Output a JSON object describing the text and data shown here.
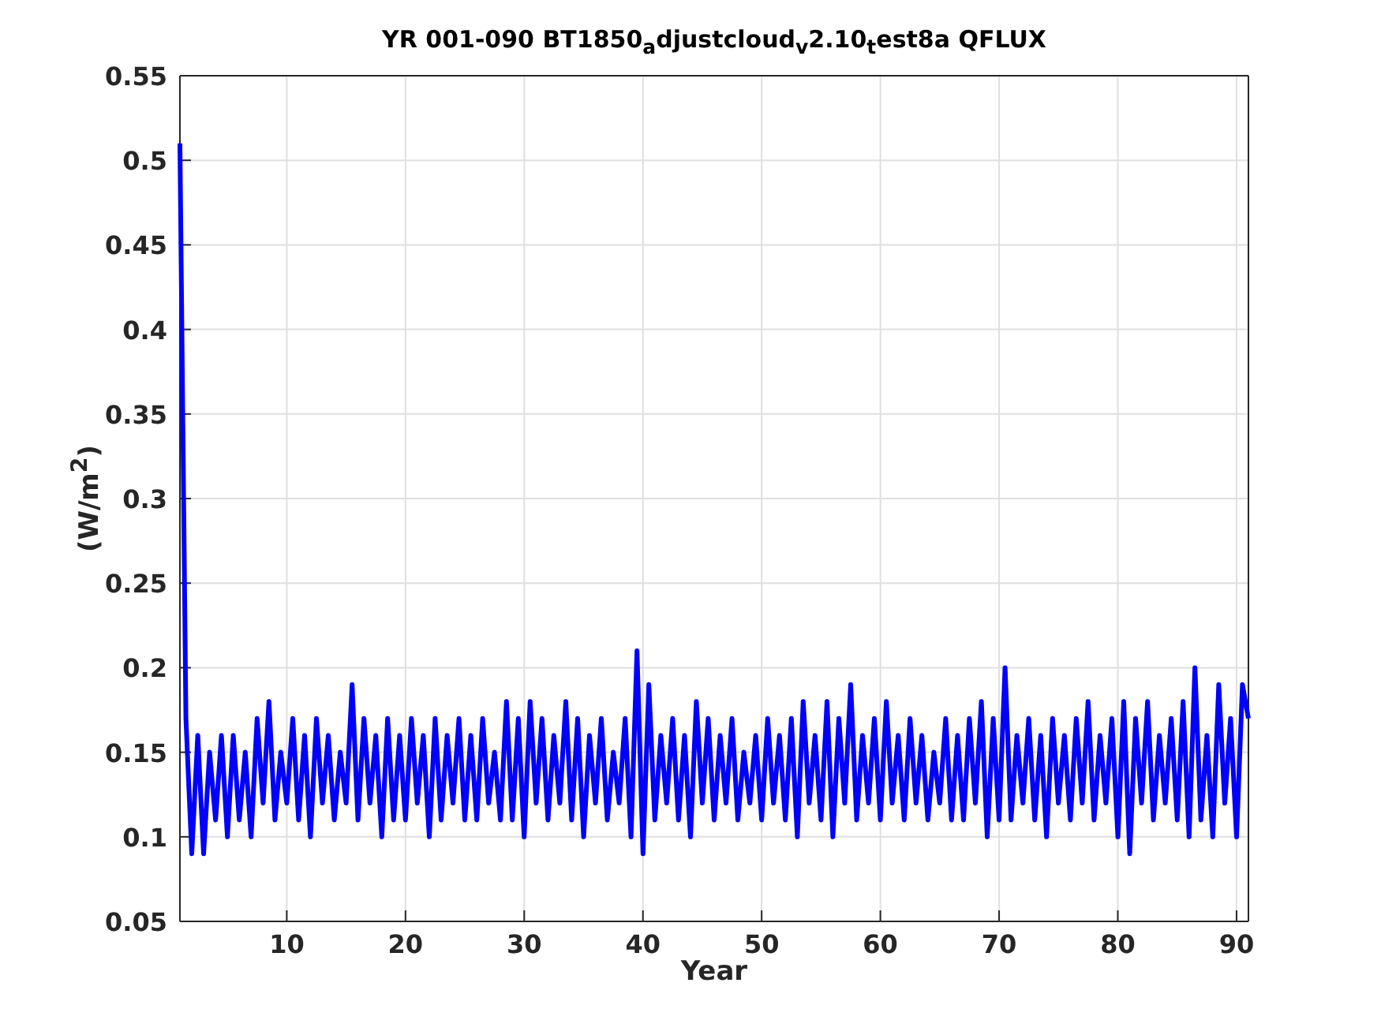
{
  "figure": {
    "chart_data": {
      "type": "line",
      "grid": true,
      "title": "YR 001-090 BT1850$_{a}$djustcloud$_{v}$2.10$_{t}$est8a QFLUX",
      "xlabel": "Year",
      "ylabel": "(W/m$^{2}$)",
      "xlim": [
        1,
        91
      ],
      "ylim": [
        0.05,
        0.55
      ],
      "xticks": [
        10,
        20,
        30,
        40,
        50,
        60,
        70,
        80,
        90
      ],
      "yticks": [
        0.05,
        0.1,
        0.15,
        0.2,
        0.25,
        0.3,
        0.35,
        0.4,
        0.45,
        0.5,
        0.55
      ],
      "x": [
        1,
        1.5,
        2,
        2.5,
        3,
        3.5,
        4,
        4.5,
        5,
        5.5,
        6,
        6.5,
        7,
        7.5,
        8,
        8.5,
        9,
        9.5,
        10,
        10.5,
        11,
        11.5,
        12,
        12.5,
        13,
        13.5,
        14,
        14.5,
        15,
        15.5,
        16,
        16.5,
        17,
        17.5,
        18,
        18.5,
        19,
        19.5,
        20,
        20.5,
        21,
        21.5,
        22,
        22.5,
        23,
        23.5,
        24,
        24.5,
        25,
        25.5,
        26,
        26.5,
        27,
        27.5,
        28,
        28.5,
        29,
        29.5,
        30,
        30.5,
        31,
        31.5,
        32,
        32.5,
        33,
        33.5,
        34,
        34.5,
        35,
        35.5,
        36,
        36.5,
        37,
        37.5,
        38,
        38.5,
        39,
        39.5,
        40,
        40.5,
        41,
        41.5,
        42,
        42.5,
        43,
        43.5,
        44,
        44.5,
        45,
        45.5,
        46,
        46.5,
        47,
        47.5,
        48,
        48.5,
        49,
        49.5,
        50,
        50.5,
        51,
        51.5,
        52,
        52.5,
        53,
        53.5,
        54,
        54.5,
        55,
        55.5,
        56,
        56.5,
        57,
        57.5,
        58,
        58.5,
        59,
        59.5,
        60,
        60.5,
        61,
        61.5,
        62,
        62.5,
        63,
        63.5,
        64,
        64.5,
        65,
        65.5,
        66,
        66.5,
        67,
        67.5,
        68,
        68.5,
        69,
        69.5,
        70,
        70.5,
        71,
        71.5,
        72,
        72.5,
        73,
        73.5,
        74,
        74.5,
        75,
        75.5,
        76,
        76.5,
        77,
        77.5,
        78,
        78.5,
        79,
        79.5,
        80,
        80.5,
        81,
        81.5,
        82,
        82.5,
        83,
        83.5,
        84,
        84.5,
        85,
        85.5,
        86,
        86.5,
        87,
        87.5,
        88,
        88.5,
        89,
        89.5,
        90,
        90.5,
        91
      ],
      "series": [
        {
          "color": "#0000ff",
          "values": [
            0.51,
            0.17,
            0.09,
            0.16,
            0.09,
            0.15,
            0.11,
            0.16,
            0.1,
            0.16,
            0.11,
            0.15,
            0.1,
            0.17,
            0.12,
            0.18,
            0.11,
            0.15,
            0.12,
            0.17,
            0.11,
            0.16,
            0.1,
            0.17,
            0.12,
            0.16,
            0.11,
            0.15,
            0.12,
            0.19,
            0.11,
            0.17,
            0.12,
            0.16,
            0.1,
            0.17,
            0.11,
            0.16,
            0.11,
            0.17,
            0.12,
            0.16,
            0.1,
            0.17,
            0.11,
            0.16,
            0.12,
            0.17,
            0.11,
            0.16,
            0.11,
            0.17,
            0.12,
            0.15,
            0.11,
            0.18,
            0.11,
            0.17,
            0.1,
            0.18,
            0.12,
            0.17,
            0.11,
            0.16,
            0.12,
            0.18,
            0.11,
            0.17,
            0.1,
            0.16,
            0.12,
            0.17,
            0.11,
            0.15,
            0.12,
            0.17,
            0.1,
            0.21,
            0.09,
            0.19,
            0.11,
            0.16,
            0.12,
            0.17,
            0.11,
            0.16,
            0.1,
            0.18,
            0.12,
            0.17,
            0.11,
            0.16,
            0.12,
            0.17,
            0.11,
            0.15,
            0.12,
            0.16,
            0.11,
            0.17,
            0.12,
            0.16,
            0.11,
            0.17,
            0.1,
            0.18,
            0.12,
            0.16,
            0.11,
            0.18,
            0.1,
            0.17,
            0.12,
            0.19,
            0.11,
            0.16,
            0.12,
            0.17,
            0.11,
            0.18,
            0.12,
            0.16,
            0.11,
            0.17,
            0.12,
            0.16,
            0.11,
            0.15,
            0.12,
            0.17,
            0.11,
            0.16,
            0.11,
            0.17,
            0.12,
            0.18,
            0.1,
            0.17,
            0.11,
            0.2,
            0.11,
            0.16,
            0.12,
            0.17,
            0.11,
            0.16,
            0.1,
            0.17,
            0.12,
            0.16,
            0.11,
            0.17,
            0.12,
            0.18,
            0.11,
            0.16,
            0.12,
            0.17,
            0.1,
            0.18,
            0.09,
            0.17,
            0.12,
            0.18,
            0.11,
            0.16,
            0.12,
            0.17,
            0.11,
            0.18,
            0.1,
            0.2,
            0.11,
            0.16,
            0.1,
            0.19,
            0.12,
            0.17,
            0.1,
            0.19,
            0.17
          ]
        }
      ]
    }
  }
}
